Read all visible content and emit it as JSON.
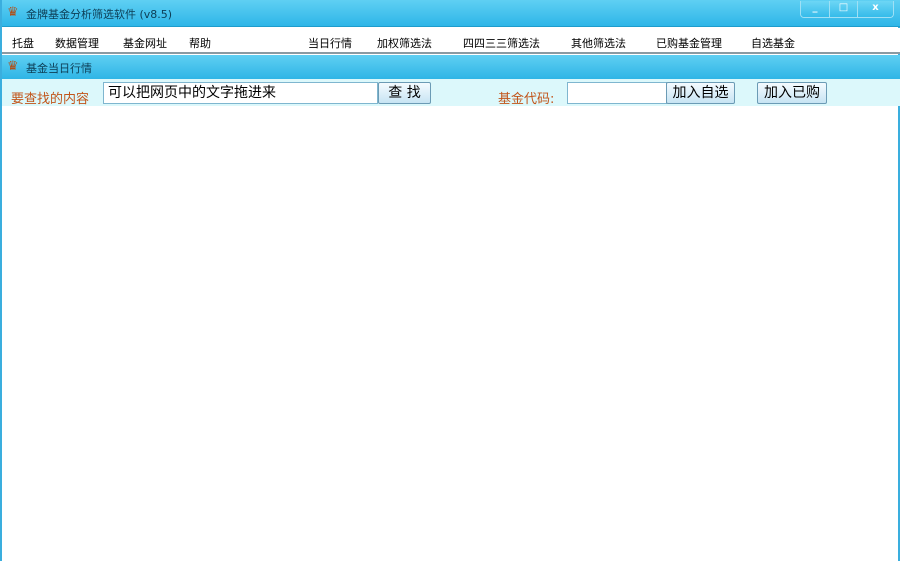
{
  "window": {
    "title": "金牌基金分析筛选软件 (v8.5)",
    "minimize": "_",
    "maximize": "□",
    "close": "x"
  },
  "menu": [
    "托盘",
    "数据管理",
    "基金网址",
    "帮助",
    "当日行情",
    "加权筛选法",
    "四四三三筛选法",
    "其他筛选法",
    "已购基金管理",
    "自选基金"
  ],
  "panel": {
    "title": "基金当日行情"
  },
  "search": {
    "label": "要查找的内容",
    "value": "可以把网页中的文字拖进来",
    "button": "查 找",
    "code_label": "基金代码:",
    "code_value": "",
    "add_watch": "加入自选",
    "add_bought": "加入已购"
  }
}
